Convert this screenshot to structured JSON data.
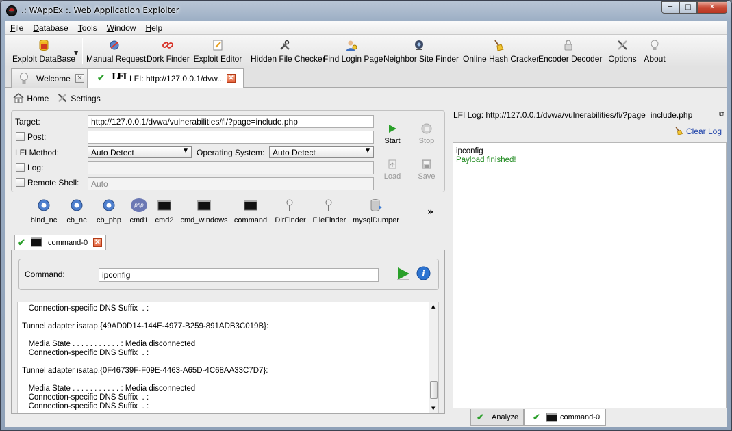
{
  "window": {
    "title": ".: WAppEx :.  Web Application Exploiter",
    "controls": [
      "minimize",
      "maximize",
      "close"
    ]
  },
  "menubar": {
    "items": [
      {
        "label": "File",
        "mnemonic": "F",
        "rest": "ile"
      },
      {
        "label": "Database",
        "mnemonic": "D",
        "rest": "atabase"
      },
      {
        "label": "Tools",
        "mnemonic": "T",
        "rest": "ools"
      },
      {
        "label": "Window",
        "mnemonic": "W",
        "rest": "indow"
      },
      {
        "label": "Help",
        "mnemonic": "H",
        "rest": "elp"
      }
    ]
  },
  "toolbar": {
    "items": [
      {
        "label": "Exploit DataBase",
        "icon": "database-icon"
      },
      {
        "label": "Manual Request",
        "icon": "request-icon"
      },
      {
        "label": "Dork Finder",
        "icon": "chain-link-icon"
      },
      {
        "label": "Exploit Editor",
        "icon": "editor-icon"
      },
      {
        "label": "Hidden File Checker",
        "icon": "tools-icon"
      },
      {
        "label": "Find Login Page",
        "icon": "user-icon"
      },
      {
        "label": "Neighbor Site Finder",
        "icon": "webcam-icon"
      },
      {
        "label": "Online Hash Cracker",
        "icon": "broom-icon"
      },
      {
        "label": "Encoder Decoder",
        "icon": "padlock-icon"
      },
      {
        "label": "Options",
        "icon": "wrench-screwdriver-icon"
      },
      {
        "label": "About",
        "icon": "lightbulb-icon"
      }
    ]
  },
  "doc_tabs": [
    {
      "label": "Welcome",
      "icon": "lightbulb-icon"
    },
    {
      "label": "LFI: http://127.0.0.1/dvw...",
      "icon_text": "LFI"
    }
  ],
  "subbar": {
    "home": "Home",
    "settings": "Settings"
  },
  "form": {
    "target_label": "Target:",
    "target_value": "http://127.0.0.1/dvwa/vulnerabilities/fi/?page=include.php",
    "post_label": "Post:",
    "lfi_method_label": "LFI Method:",
    "lfi_method_value": "Auto Detect",
    "os_label": "Operating System:",
    "os_value": "Auto Detect",
    "log_label": "Log:",
    "remote_shell_label": "Remote Shell:",
    "remote_shell_value": "Auto"
  },
  "actions": {
    "start": "Start",
    "stop": "Stop",
    "load": "Load",
    "save": "Save"
  },
  "payloads": {
    "items": [
      "bind_nc",
      "cb_nc",
      "cb_php",
      "cmd1",
      "cmd2",
      "cmd_windows",
      "command",
      "DirFinder",
      "FileFinder",
      "mysqlDumper"
    ],
    "more": "»",
    "php_badge": "php"
  },
  "command_tab": {
    "label": "command-0"
  },
  "command": {
    "label": "Command:",
    "value": "ipconfig"
  },
  "output": {
    "lines": [
      "   Connection-specific DNS Suffix  . :",
      "",
      "Tunnel adapter isatap.{49AD0D14-144E-4977-B259-891ADB3C019B}:",
      "",
      "   Media State . . . . . . . . . . . : Media disconnected",
      "   Connection-specific DNS Suffix  . :",
      "",
      "Tunnel adapter isatap.{0F46739F-F09E-4463-A65D-4C68AA33C7D7}:",
      "",
      "   Media State . . . . . . . . . . . : Media disconnected",
      "   Connection-specific DNS Suffix  . :",
      "   Connection-specific DNS Suffix  . :"
    ]
  },
  "log": {
    "title": "LFI Log: http://127.0.0.1/dvwa/vulnerabilities/fi/?page=include.php",
    "clear": "Clear Log",
    "lines": [
      {
        "text": "ipconfig",
        "color": "#000000"
      },
      {
        "text": "Payload finished!",
        "color": "#1f8a1f"
      }
    ]
  },
  "bottom_tabs": [
    "Analyze",
    "command-0"
  ],
  "colors": {
    "accent": "#2da02d",
    "link": "#1a3fa8"
  }
}
